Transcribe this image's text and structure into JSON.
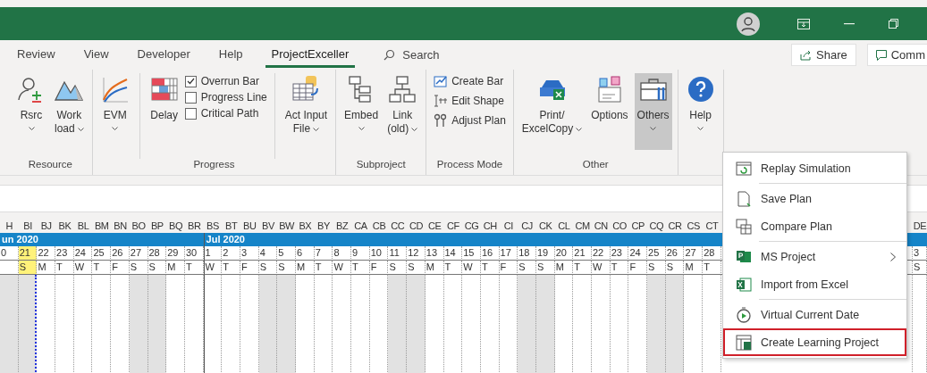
{
  "tabs": [
    {
      "label": "Review",
      "selected": false
    },
    {
      "label": "View",
      "selected": false
    },
    {
      "label": "Developer",
      "selected": false
    },
    {
      "label": "Help",
      "selected": false
    },
    {
      "label": "ProjectExceller",
      "selected": true
    }
  ],
  "search": {
    "placeholder": "Search"
  },
  "header_buttons": [
    "Share",
    "Comm"
  ],
  "ribbon": {
    "groups": [
      {
        "label": "Resource",
        "items": [
          {
            "kind": "large",
            "lines": [
              "Rsrc"
            ],
            "dropdown": true,
            "pressed": false,
            "separator": false
          },
          {
            "kind": "large",
            "lines": [
              "Work",
              "load"
            ],
            "dropdown": true,
            "pressed": false,
            "separator": false
          }
        ]
      },
      {
        "label": "Progress",
        "items": [
          {
            "kind": "large",
            "lines": [
              "EVM"
            ],
            "dropdown": true,
            "pressed": false,
            "separator": false
          },
          {
            "kind": "large",
            "lines": [
              "Delay"
            ],
            "dropdown": false,
            "pressed": false,
            "separator": true
          },
          {
            "kind": "checks",
            "checks": [
              {
                "label": "Overrun Bar",
                "checked": true
              },
              {
                "label": "Progress Line",
                "checked": false
              },
              {
                "label": "Critical Path",
                "checked": false
              }
            ]
          },
          {
            "kind": "large",
            "lines": [
              "Act Input",
              "File"
            ],
            "dropdown": true,
            "pressed": false,
            "separator": true
          }
        ]
      },
      {
        "label": "Subproject",
        "items": [
          {
            "kind": "large",
            "lines": [
              "Embed"
            ],
            "dropdown": true,
            "pressed": false,
            "separator": false
          },
          {
            "kind": "large",
            "lines": [
              "Link",
              "(old)"
            ],
            "dropdown": true,
            "pressed": false,
            "separator": false
          }
        ]
      },
      {
        "label": "Process Mode",
        "items": [
          {
            "kind": "smalls",
            "buttons": [
              "Create Bar",
              "Edit Shape",
              "Adjust Plan"
            ]
          }
        ]
      },
      {
        "label": "Other",
        "items": [
          {
            "kind": "large",
            "lines": [
              "Print/",
              "ExcelCopy"
            ],
            "dropdown": true,
            "pressed": false,
            "separator": false
          },
          {
            "kind": "large",
            "lines": [
              "Options"
            ],
            "dropdown": false,
            "pressed": false,
            "separator": false
          },
          {
            "kind": "large",
            "lines": [
              "Others"
            ],
            "dropdown": true,
            "pressed": true,
            "separator": false
          }
        ]
      },
      {
        "items": [
          {
            "kind": "large",
            "lines": [
              "Help"
            ],
            "dropdown": true,
            "pressed": false,
            "separator": false
          }
        ]
      }
    ]
  },
  "columns": [
    {
      "letter": "H",
      "day": "0",
      "weekend": true,
      "today": false,
      "month": "un 2020"
    },
    {
      "letter": "BI",
      "day": "21",
      "weekday": "S",
      "weekend": true,
      "today": true
    },
    {
      "letter": "BJ",
      "day": "22",
      "weekday": "M",
      "weekend": false,
      "today": false
    },
    {
      "letter": "BK",
      "day": "23",
      "weekday": "T",
      "weekend": false,
      "today": false
    },
    {
      "letter": "BL",
      "day": "24",
      "weekday": "W",
      "weekend": false,
      "today": false
    },
    {
      "letter": "BM",
      "day": "25",
      "weekday": "T",
      "weekend": false,
      "today": false
    },
    {
      "letter": "BN",
      "day": "26",
      "weekday": "F",
      "weekend": false,
      "today": false
    },
    {
      "letter": "BO",
      "day": "27",
      "weekday": "S",
      "weekend": true,
      "today": false
    },
    {
      "letter": "BP",
      "day": "28",
      "weekday": "S",
      "weekend": true,
      "today": false
    },
    {
      "letter": "BQ",
      "day": "29",
      "weekday": "M",
      "weekend": false,
      "today": false
    },
    {
      "letter": "BR",
      "day": "30",
      "weekday": "T",
      "weekend": false,
      "today": false
    },
    {
      "letter": "BS",
      "day": "1",
      "weekday": "W",
      "weekend": false,
      "today": false,
      "month": "Jul 2020"
    },
    {
      "letter": "BT",
      "day": "2",
      "weekday": "T",
      "weekend": false,
      "today": false
    },
    {
      "letter": "BU",
      "day": "3",
      "weekday": "F",
      "weekend": false,
      "today": false
    },
    {
      "letter": "BV",
      "day": "4",
      "weekday": "S",
      "weekend": true,
      "today": false
    },
    {
      "letter": "BW",
      "day": "5",
      "weekday": "S",
      "weekend": true,
      "today": false
    },
    {
      "letter": "BX",
      "day": "6",
      "weekday": "M",
      "weekend": false,
      "today": false
    },
    {
      "letter": "BY",
      "day": "7",
      "weekday": "T",
      "weekend": false,
      "today": false
    },
    {
      "letter": "BZ",
      "day": "8",
      "weekday": "W",
      "weekend": false,
      "today": false
    },
    {
      "letter": "CA",
      "day": "9",
      "weekday": "T",
      "weekend": false,
      "today": false
    },
    {
      "letter": "CB",
      "day": "10",
      "weekday": "F",
      "weekend": false,
      "today": false
    },
    {
      "letter": "CC",
      "day": "11",
      "weekday": "S",
      "weekend": true,
      "today": false
    },
    {
      "letter": "CD",
      "day": "12",
      "weekday": "S",
      "weekend": true,
      "today": false
    },
    {
      "letter": "CE",
      "day": "13",
      "weekday": "M",
      "weekend": false,
      "today": false
    },
    {
      "letter": "CF",
      "day": "14",
      "weekday": "T",
      "weekend": false,
      "today": false
    },
    {
      "letter": "CG",
      "day": "15",
      "weekday": "W",
      "weekend": false,
      "today": false
    },
    {
      "letter": "CH",
      "day": "16",
      "weekday": "T",
      "weekend": false,
      "today": false
    },
    {
      "letter": "CI",
      "day": "17",
      "weekday": "F",
      "weekend": false,
      "today": false
    },
    {
      "letter": "CJ",
      "day": "18",
      "weekday": "S",
      "weekend": true,
      "today": false
    },
    {
      "letter": "CK",
      "day": "19",
      "weekday": "S",
      "weekend": true,
      "today": false
    },
    {
      "letter": "CL",
      "day": "20",
      "weekday": "M",
      "weekend": false,
      "today": false
    },
    {
      "letter": "CM",
      "day": "21",
      "weekday": "T",
      "weekend": false,
      "today": false
    },
    {
      "letter": "CN",
      "day": "22",
      "weekday": "W",
      "weekend": false,
      "today": false
    },
    {
      "letter": "CO",
      "day": "23",
      "weekday": "T",
      "weekend": false,
      "today": false
    },
    {
      "letter": "CP",
      "day": "24",
      "weekday": "F",
      "weekend": false,
      "today": false
    },
    {
      "letter": "CQ",
      "day": "25",
      "weekday": "S",
      "weekend": true,
      "today": false
    },
    {
      "letter": "CR",
      "day": "26",
      "weekday": "S",
      "weekend": true,
      "today": false
    },
    {
      "letter": "CS",
      "day": "27",
      "weekday": "M",
      "weekend": false,
      "today": false
    },
    {
      "letter": "CT",
      "day": "28",
      "weekday": "T",
      "weekend": false,
      "today": false
    }
  ],
  "edge_column": {
    "letter": "DE",
    "day": "3",
    "weekday": "S"
  },
  "menu": {
    "items": [
      {
        "label": "Replay Simulation",
        "separator": false,
        "submenu": false,
        "highlighted": false
      },
      {
        "label": "Save Plan",
        "separator": true,
        "submenu": false,
        "highlighted": false
      },
      {
        "label": "Compare Plan",
        "separator": false,
        "submenu": false,
        "highlighted": false
      },
      {
        "label": "MS Project",
        "separator": true,
        "submenu": true,
        "highlighted": false
      },
      {
        "label": "Import from Excel",
        "separator": false,
        "submenu": false,
        "highlighted": false
      },
      {
        "label": "Virtual Current Date",
        "separator": true,
        "submenu": false,
        "highlighted": false
      },
      {
        "label": "Create Learning Project",
        "separator": false,
        "submenu": false,
        "highlighted": true
      }
    ]
  }
}
